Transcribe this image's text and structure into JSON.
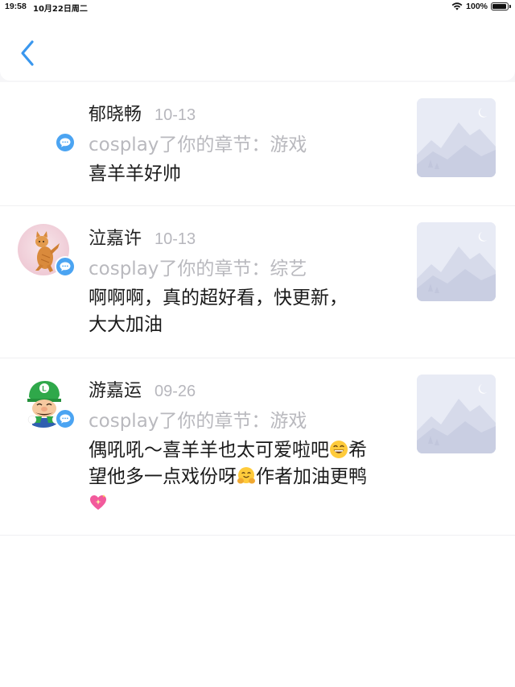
{
  "status_bar": {
    "time": "19:58",
    "date": "10月22日周二",
    "battery": "100%"
  },
  "nav": {
    "back_icon": "chevron-left-icon"
  },
  "comments": [
    {
      "name": "郁晓畅",
      "date": "10-13",
      "action": "cosplay了你的章节：游戏",
      "text": "喜羊羊好帅",
      "avatar": "none"
    },
    {
      "name": "泣嘉许",
      "date": "10-13",
      "action": "cosplay了你的章节：综艺",
      "text": "啊啊啊，真的超好看，快更新，大大加油",
      "avatar": "cat-avatar"
    },
    {
      "name": "游嘉运",
      "date": "09-26",
      "action": "cosplay了你的章节：游戏",
      "text_parts": [
        "偶吼吼～喜羊羊也太可爱啦吧",
        "希望他多一点戏份呀",
        "作者加油更鸭"
      ],
      "emojis": [
        "grinning-face-emoji",
        "hugging-face-emoji",
        "sparkling-heart-emoji"
      ],
      "avatar": "green-cap-cartoon-avatar"
    }
  ],
  "colors": {
    "accent": "#4ba4f2",
    "name": "#222222",
    "muted": "#b9b9be",
    "text": "#1a1a1a"
  }
}
